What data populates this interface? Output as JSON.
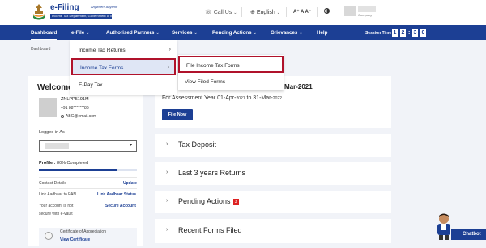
{
  "header": {
    "brand_title": "e-Filing",
    "brand_tag": "Anywhere Anytime",
    "brand_sub": "Income Tax Department, Government of India",
    "call_us": "Call Us",
    "language": "English",
    "font_controls": "A⁺ A A⁻",
    "company": "Company"
  },
  "nav": {
    "items": [
      {
        "label": "Dashboard"
      },
      {
        "label": "e-File"
      },
      {
        "label": "Authorised Partners"
      },
      {
        "label": "Services"
      },
      {
        "label": "Pending Actions"
      },
      {
        "label": "Grievances"
      },
      {
        "label": "Help"
      }
    ],
    "session_label": "Session Time",
    "session_digits": [
      "1",
      "2",
      "3",
      "0"
    ]
  },
  "breadcrumb": "Dashboard",
  "efile_menu": {
    "items": [
      {
        "label": "Income Tax Returns",
        "arrow": "›"
      },
      {
        "label": "Income Tax Forms",
        "arrow": "›"
      },
      {
        "label": "E-Pay Tax"
      }
    ]
  },
  "forms_submenu": {
    "items": [
      {
        "label": "File Income Tax Forms"
      },
      {
        "label": "View Filed Forms"
      }
    ]
  },
  "profile": {
    "welcome": "Welcome B",
    "pan": "ZNLPP5191M",
    "phone": "+91 88*******86",
    "email": "ABC@email.com",
    "logged_in_label": "Logged in As",
    "profile_label": "Profile :",
    "profile_value": "80% Completed",
    "profile_progress": 0.8,
    "contact_label": "Contact Details",
    "contact_link": "Update",
    "aadhaar_label": "Link Aadhaar to PAN",
    "aadhaar_link": "Link Aadhaar Status",
    "secure_label_1": "Your account is not",
    "secure_label_2": "secure with e-vault",
    "secure_link": "Secure Account",
    "cert_label": "Certificate of Appreciation",
    "cert_link": "View Certificate"
  },
  "main": {
    "due_title": "Mar-2021",
    "ay_prefix": "For Assessment Year 01-Apr-",
    "ay_year1": "2021",
    "ay_mid": " to 31-Mar-",
    "ay_year2": "2022",
    "file_now": "File Now",
    "accordions": [
      {
        "label": "Tax Deposit"
      },
      {
        "label": "Last 3 years Returns"
      },
      {
        "label": "Pending Actions",
        "badge": "3"
      },
      {
        "label": "Recent Forms Filed"
      }
    ]
  },
  "chatbot": {
    "label": "Chatbot"
  },
  "colors": {
    "brand": "#1c3f94",
    "highlight": "#b0122b",
    "badge": "#dd2222"
  }
}
